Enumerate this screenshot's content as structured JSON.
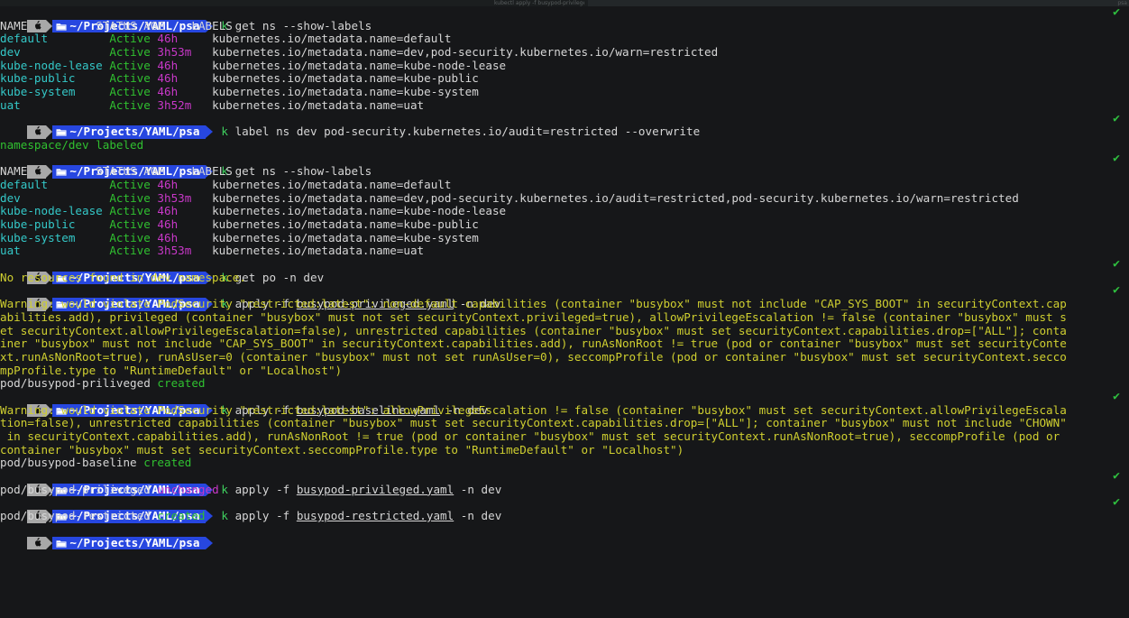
{
  "window": {
    "chrome_title": "kubectl apply -f busypod-privileged.yaml",
    "chrome_title_right": "psa"
  },
  "terminal": {
    "prompt": {
      "apple_icon": "apple-icon",
      "folder_icon": "folder-icon",
      "path": "~/Projects/YAML/psa",
      "success_marker": "✔"
    },
    "colors": {
      "background": "#161719",
      "foreground": "#d6d6d6",
      "prompt_path_bg": "#2747e0",
      "prompt_apple_bg": "#a8a8a8",
      "green": "#30c030",
      "cyan": "#34c8c8",
      "magenta": "#c838c8",
      "yellow": "#cfcf30",
      "check": "#2fbf3f"
    },
    "commands": {
      "cmd1": "k get ns --show-labels",
      "cmd2": "k label ns dev pod-security.kubernetes.io/audit=restricted --overwrite",
      "cmd3": "k get ns --show-labels",
      "cmd4": "k get po -n dev",
      "cmd5": "k apply -f busypod-privileged.yaml -n dev",
      "cmd6": "k apply -f busypod-baseline.yaml -n dev",
      "cmd7": "k apply -f busypod-privileged.yaml -n dev",
      "cmd8": "k apply -f busypod-restricted.yaml -n dev"
    },
    "cmd_parts": {
      "k": "k",
      "c1_rest": " get ns --show-labels",
      "c2_rest": " label ns dev pod-security.kubernetes.io/audit=restricted --overwrite",
      "c4_rest": " get po -n dev",
      "apply_pre": " apply -f ",
      "file_privileged": "busypod-privileged.yaml",
      "file_baseline": "busypod-baseline.yaml",
      "file_restricted": "busypod-restricted.yaml",
      "apply_post": " -n dev"
    },
    "ns_table_1": {
      "header": {
        "name": "NAME",
        "status": "STATUS",
        "age": "AGE",
        "labels": "LABELS"
      },
      "rows": [
        {
          "name": "default",
          "status": "Active",
          "age": "46h",
          "labels": "kubernetes.io/metadata.name=default"
        },
        {
          "name": "dev",
          "status": "Active",
          "age": "3h53m",
          "labels": "kubernetes.io/metadata.name=dev,pod-security.kubernetes.io/warn=restricted"
        },
        {
          "name": "kube-node-lease",
          "status": "Active",
          "age": "46h",
          "labels": "kubernetes.io/metadata.name=kube-node-lease"
        },
        {
          "name": "kube-public",
          "status": "Active",
          "age": "46h",
          "labels": "kubernetes.io/metadata.name=kube-public"
        },
        {
          "name": "kube-system",
          "status": "Active",
          "age": "46h",
          "labels": "kubernetes.io/metadata.name=kube-system"
        },
        {
          "name": "uat",
          "status": "Active",
          "age": "3h52m",
          "labels": "kubernetes.io/metadata.name=uat"
        }
      ]
    },
    "label_result": "namespace/dev labeled",
    "ns_table_2": {
      "header": {
        "name": "NAME",
        "status": "STATUS",
        "age": "AGE",
        "labels": "LABELS"
      },
      "rows": [
        {
          "name": "default",
          "status": "Active",
          "age": "46h",
          "labels": "kubernetes.io/metadata.name=default"
        },
        {
          "name": "dev",
          "status": "Active",
          "age": "3h53m",
          "labels": "kubernetes.io/metadata.name=dev,pod-security.kubernetes.io/audit=restricted,pod-security.kubernetes.io/warn=restricted"
        },
        {
          "name": "kube-node-lease",
          "status": "Active",
          "age": "46h",
          "labels": "kubernetes.io/metadata.name=kube-node-lease"
        },
        {
          "name": "kube-public",
          "status": "Active",
          "age": "46h",
          "labels": "kubernetes.io/metadata.name=kube-public"
        },
        {
          "name": "kube-system",
          "status": "Active",
          "age": "46h",
          "labels": "kubernetes.io/metadata.name=kube-system"
        },
        {
          "name": "uat",
          "status": "Active",
          "age": "3h53m",
          "labels": "kubernetes.io/metadata.name=uat"
        }
      ]
    },
    "no_resources": "No resources found in dev namespace.",
    "warning_privileged": {
      "line1": "Warning: would violate PodSecurity \"restricted:latest\": non-default capabilities (container \"busybox\" must not include \"CAP_SYS_BOOT\" in securityContext.cap",
      "line2": "abilities.add), privileged (container \"busybox\" must not set securityContext.privileged=true), allowPrivilegeEscalation != false (container \"busybox\" must s",
      "line3": "et securityContext.allowPrivilegeEscalation=false), unrestricted capabilities (container \"busybox\" must set securityContext.capabilities.drop=[\"ALL\"]; conta",
      "line4": "iner \"busybox\" must not include \"CAP_SYS_BOOT\" in securityContext.capabilities.add), runAsNonRoot != true (pod or container \"busybox\" must set securityConte",
      "line5": "xt.runAsNonRoot=true), runAsUser=0 (container \"busybox\" must not set runAsUser=0), seccompProfile (pod or container \"busybox\" must set securityContext.secco",
      "line6": "mpProfile.type to \"RuntimeDefault\" or \"Localhost\")"
    },
    "result_privileged_created": {
      "resource": "pod/busypod-priliveged",
      "status": "created"
    },
    "warning_baseline": {
      "line1": "Warning: would violate PodSecurity \"restricted:latest\": allowPrivilegeEscalation != false (container \"busybox\" must set securityContext.allowPrivilegeEscala",
      "line2": "tion=false), unrestricted capabilities (container \"busybox\" must set securityContext.capabilities.drop=[\"ALL\"]; container \"busybox\" must not include \"CHOWN\"",
      "line3": " in securityContext.capabilities.add), runAsNonRoot != true (pod or container \"busybox\" must set securityContext.runAsNonRoot=true), seccompProfile (pod or",
      "line4": "container \"busybox\" must set securityContext.seccompProfile.type to \"RuntimeDefault\" or \"Localhost\")"
    },
    "result_baseline_created": {
      "resource": "pod/busypod-baseline",
      "status": "created"
    },
    "result_privileged_unchanged": {
      "resource": "pod/busypod-priliveged",
      "status": "unchanged"
    },
    "result_restricted_created": {
      "resource": "pod/busypod-restricted",
      "status": "created"
    }
  }
}
